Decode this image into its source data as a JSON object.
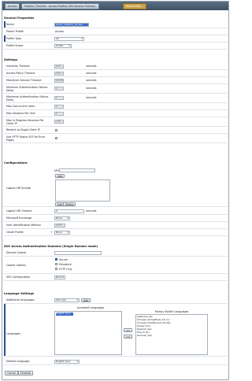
{
  "breadcrumb": [
    "Access",
    "Profiles / Policies : Access Profiles (Per-Session Policies)",
    "New Profile..."
  ],
  "general": {
    "section": "General Properties",
    "name_label": "Name",
    "name_value": "demo_network_access",
    "parent_label": "Parent Profile",
    "parent_value": "access",
    "type_label": "Profile Type",
    "type_value": "All",
    "scope_label": "Profile Scope",
    "scope_value": "Profile"
  },
  "settings": {
    "section": "Settings",
    "inactivity_label": "Inactivity Timeout",
    "inactivity_value": "900",
    "policy_label": "Access Policy Timeout",
    "policy_value": "300",
    "max_session_label": "Maximum Session Timeout",
    "max_session_value": "604800",
    "min_auth_label": "Minimum Authentication Failure Delay",
    "min_auth_value": "2",
    "max_auth_label": "Maximum Authentication Failure Delay",
    "max_auth_value": "5",
    "concurrent_label": "Max Concurrent Users",
    "concurrent_value": "0",
    "per_user_label": "Max Sessions Per User",
    "per_user_value": "0",
    "inprogress_label": "Max In Progress Sessions Per Client IP",
    "inprogress_value": "128",
    "restrict_label": "Restrict to Single Client IP",
    "http503_label": "Use HTTP Status 503 for Error Pages",
    "seconds": "seconds"
  },
  "config": {
    "section": "Configurations",
    "logout_label": "Logout URI Include",
    "uri_label": "URI:",
    "add_label": "Add",
    "edit_label": "Edit",
    "delete_label": "Delete",
    "logout_timeout_label": "Logout URI Timeout",
    "logout_timeout_value": "5",
    "exchange_label": "Microsoft Exchange",
    "exchange_value": "None",
    "user_id_label": "User Identification Method",
    "user_id_value": "HTTP",
    "oauth_label": "OAuth Profile",
    "oauth_value": "None",
    "seconds": "seconds"
  },
  "sso": {
    "section": "SSO Across Authentication Domains (Single Domain mode)",
    "domain_cookie_label": "Domain Cookie",
    "cookie_options_label": "Cookie Options",
    "secure_label": "Secure",
    "persistent_label": "Persistent",
    "httponly_label": "HTTP Only",
    "sso_config_label": "SSO Configuration",
    "sso_config_value": "None"
  },
  "lang": {
    "section": "Language Settings",
    "additional_label": "Additional Languages",
    "additional_value": "Afar (aa)",
    "add_label": "Add",
    "languages_label": "Languages",
    "accepted_title": "Accepted Languages",
    "factory_title": "Factory BuiltIn Languages",
    "accepted": [
      "English (en)"
    ],
    "factory": [
      "Japanese (ja)",
      "Chinese (Simplified) (zh-cn)",
      "Chinese (Traditional) (zh-tw)",
      "Korean (ko)",
      "Spanish (es)",
      "French (fr)",
      "German (de)"
    ],
    "move_left": "<<",
    "move_right": ">>",
    "default_label": "Default Language",
    "default_value": "English (en)"
  },
  "footer": {
    "cancel": "Cancel",
    "finished": "Finished"
  }
}
